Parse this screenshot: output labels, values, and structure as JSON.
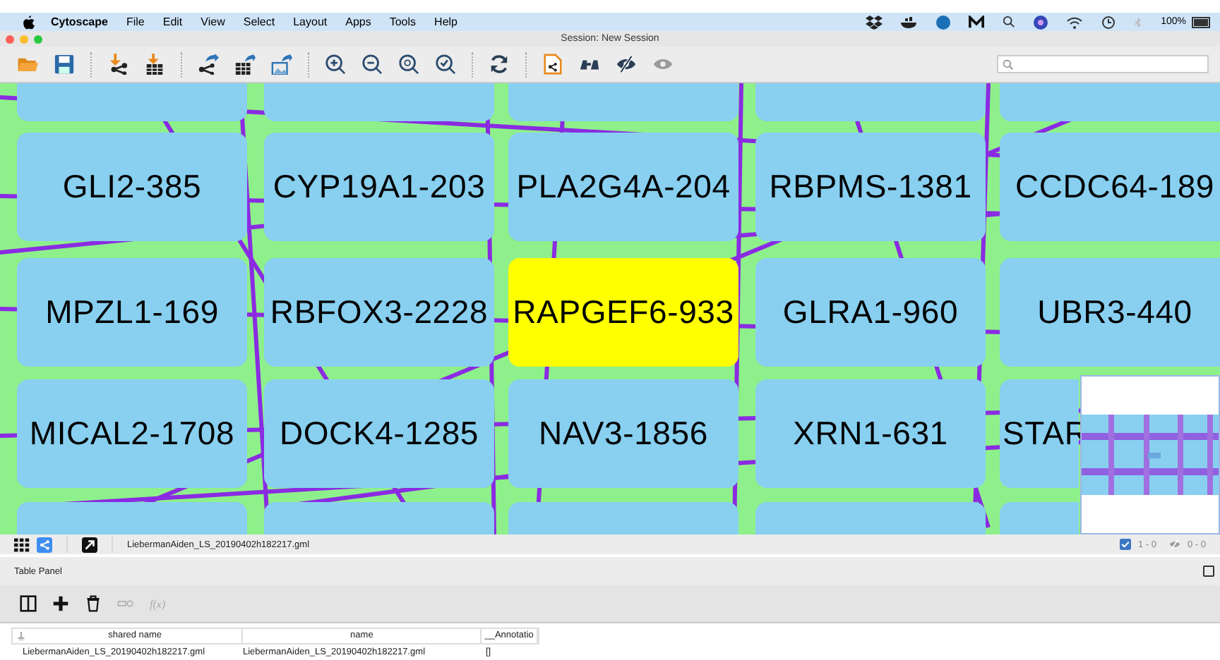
{
  "menu_bar": {
    "app_name": "Cytoscape",
    "items": [
      "File",
      "Edit",
      "View",
      "Select",
      "Layout",
      "Apps",
      "Tools",
      "Help"
    ],
    "battery": "100%"
  },
  "window": {
    "title": "Session: New Session"
  },
  "nodes": [
    {
      "label": "GLI2-385",
      "selected": false
    },
    {
      "label": "CYP19A1-203",
      "selected": false
    },
    {
      "label": "PLA2G4A-204",
      "selected": false
    },
    {
      "label": "RBPMS-1381",
      "selected": false
    },
    {
      "label": "CCDC64-189",
      "selected": false
    },
    {
      "label": "MPZL1-169",
      "selected": false
    },
    {
      "label": "RBFOX3-2228",
      "selected": false
    },
    {
      "label": "RAPGEF6-933",
      "selected": true
    },
    {
      "label": "GLRA1-960",
      "selected": false
    },
    {
      "label": "UBR3-440",
      "selected": false
    },
    {
      "label": "MICAL2-1708",
      "selected": false
    },
    {
      "label": "DOCK4-1285",
      "selected": false
    },
    {
      "label": "NAV3-1856",
      "selected": false
    },
    {
      "label": "XRN1-631",
      "selected": false
    },
    {
      "label": "STAR",
      "selected": false
    }
  ],
  "network_bar": {
    "network_name": "LiebermanAiden_LS_20190402h182217.gml",
    "selected_count": "1 - 0",
    "hidden_count": "0 - 0"
  },
  "table_panel": {
    "title": "Table Panel",
    "function_label": "f(x)",
    "columns": [
      "shared name",
      "name",
      "__Annotatio"
    ],
    "rows": [
      [
        "LiebermanAiden_LS_20190402h182217.gml",
        "LiebermanAiden_LS_20190402h182217.gml",
        "[]"
      ]
    ]
  }
}
